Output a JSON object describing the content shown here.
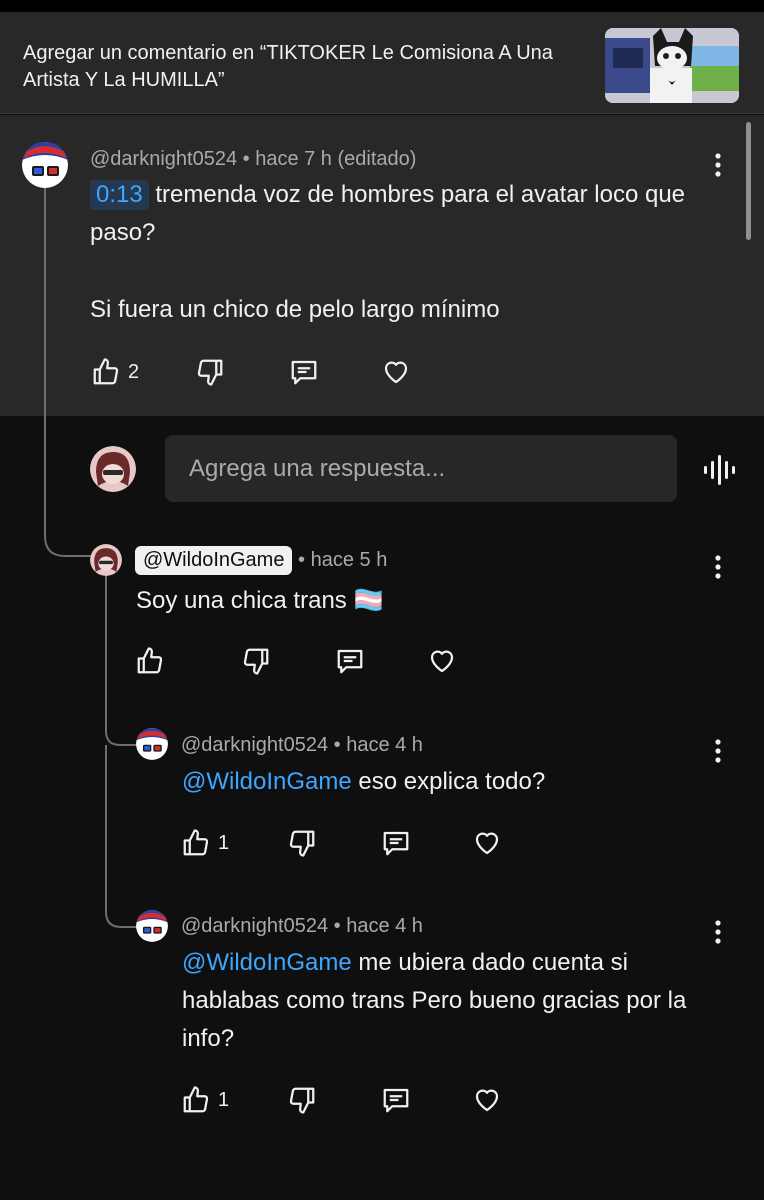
{
  "header": {
    "title": "Agregar un comentario en “TIKTOKER Le Comisiona A Una Artista Y La HUMILLA”"
  },
  "main_comment": {
    "author": "@darknight0524",
    "meta": " • hace 7 h (editado)",
    "timestamp": "0:13",
    "text_line1": " tremenda voz de hombres para el avatar loco que paso?",
    "text_line2": "Si fuera un chico de pelo largo mínimo",
    "likes": "2"
  },
  "reply_input": {
    "placeholder": "Agrega una respuesta..."
  },
  "replies": [
    {
      "author": "@WildoInGame",
      "meta": " • hace 5 h",
      "text": "Soy una chica trans 🏳️‍⚧️",
      "likes": ""
    },
    {
      "author": "@darknight0524",
      "meta": " • hace 4 h",
      "mention": "@WildoInGame",
      "text": " eso explica todo?",
      "likes": "1"
    },
    {
      "author": "@darknight0524",
      "meta": " • hace 4 h",
      "mention": "@WildoInGame",
      "text": " me ubiera dado cuenta si hablabas como trans Pero bueno gracias por la info?",
      "likes": "1"
    }
  ],
  "icons": [
    "like-icon",
    "dislike-icon",
    "reply-icon",
    "heart-icon",
    "more-icon",
    "voice-search-icon"
  ],
  "colors": {
    "background": "#0f0f0f",
    "panel": "#282828",
    "accent": "#3ea6ff",
    "muted": "#aaaaaa"
  }
}
